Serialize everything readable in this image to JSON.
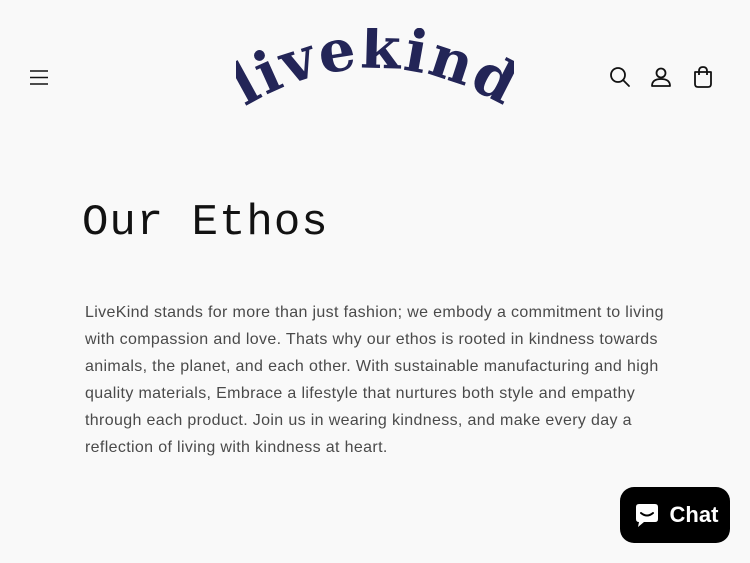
{
  "header": {
    "menu_icon": "hamburger-menu-icon",
    "logo_text": "livekind",
    "logo_color": "#232557",
    "search_icon": "search-icon",
    "account_icon": "user-icon",
    "cart_icon": "shopping-bag-icon"
  },
  "main": {
    "title": "Our Ethos",
    "paragraph": "LiveKind stands for more than just fashion; we embody a commitment to living with compassion and love. Thats why our ethos is rooted in kindness towards animals, the planet, and each other. With sustainable manufacturing and high quality materials,  Embrace a lifestyle that nurtures both style and empathy through each product. Join us in wearing kindness, and make every day a reflection of living with kindness at heart."
  },
  "chat_widget": {
    "label": "Chat",
    "icon": "chat-bubble-icon",
    "background": "#000000"
  }
}
